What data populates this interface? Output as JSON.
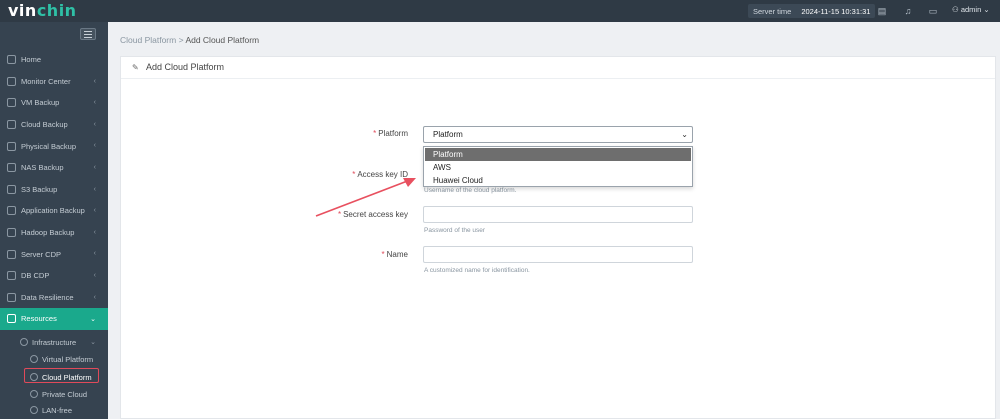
{
  "topbar": {
    "logo_a": "vin",
    "logo_b": "chin",
    "server_time_label": "Server time",
    "server_time_value": "2024-11-15 10:31:31",
    "user": "admin"
  },
  "sidebar": {
    "items": [
      {
        "label": "Home",
        "chev": ""
      },
      {
        "label": "Monitor Center",
        "chev": "‹"
      },
      {
        "label": "VM Backup",
        "chev": "‹"
      },
      {
        "label": "Cloud Backup",
        "chev": "‹"
      },
      {
        "label": "Physical Backup",
        "chev": "‹"
      },
      {
        "label": "NAS Backup",
        "chev": "‹"
      },
      {
        "label": "S3 Backup",
        "chev": "‹"
      },
      {
        "label": "Application Backup",
        "chev": "‹"
      },
      {
        "label": "Hadoop Backup",
        "chev": "‹"
      },
      {
        "label": "Server CDP",
        "chev": "‹"
      },
      {
        "label": "DB CDP",
        "chev": "‹"
      },
      {
        "label": "Data Resilience",
        "chev": "‹"
      },
      {
        "label": "Resources",
        "chev": "⌄"
      }
    ],
    "sub": {
      "infrastructure": "Infrastructure",
      "virtual_platform": "Virtual Platform",
      "cloud_platform": "Cloud Platform",
      "private_cloud": "Private Cloud",
      "lan_free": "LAN-free"
    }
  },
  "breadcrumb": {
    "parent": "Cloud Platform",
    "sep": " > ",
    "current": "Add Cloud Platform"
  },
  "panel": {
    "title": "Add Cloud Platform"
  },
  "form": {
    "platform_label": "Platform",
    "platform_value": "Platform",
    "platform_options": [
      "Platform",
      "AWS",
      "Huawei Cloud"
    ],
    "access_key_label": "Access key ID",
    "access_key_help": "Username of the cloud platform.",
    "secret_key_label": "Secret access key",
    "secret_key_help": "Password of the user",
    "name_label": "Name",
    "name_help": "A customized name for identification."
  },
  "colors": {
    "accent": "#1aa98c",
    "topbar": "#2f3a45",
    "sidebar": "#364350",
    "highlight": "#e04a5a"
  }
}
